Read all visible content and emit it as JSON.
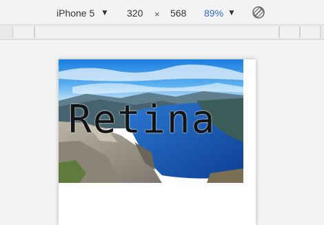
{
  "toolbar": {
    "device": "iPhone 5",
    "width": "320",
    "times": "×",
    "height": "568",
    "zoom": "89%"
  },
  "icons": {
    "device_dropdown": "chevron-down-icon",
    "zoom_dropdown": "chevron-down-icon",
    "rotate": "rotate-icon"
  },
  "hero": {
    "text": "Retina"
  },
  "colors": {
    "zoom_text": "#3367d6",
    "toolbar_bg": "#f3f3f3",
    "sky": "#2f8ee6",
    "fjord": "#1f5db3"
  }
}
